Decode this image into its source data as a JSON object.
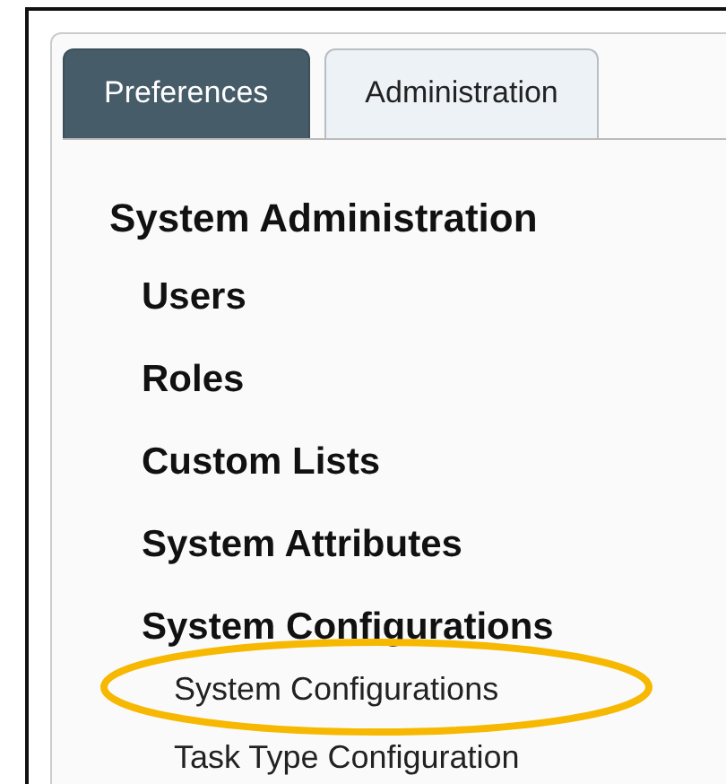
{
  "tabs": [
    {
      "label": "Preferences",
      "selected": true
    },
    {
      "label": "Administration",
      "selected": false
    }
  ],
  "tree": {
    "label": "System Administration",
    "children": [
      {
        "label": "Users"
      },
      {
        "label": "Roles"
      },
      {
        "label": "Custom Lists"
      },
      {
        "label": "System Attributes"
      },
      {
        "label": "System Configurations",
        "children": [
          {
            "label": "System Configurations",
            "highlighted": true
          },
          {
            "label": "Task Type Configuration",
            "highlighted": false
          }
        ]
      }
    ]
  }
}
